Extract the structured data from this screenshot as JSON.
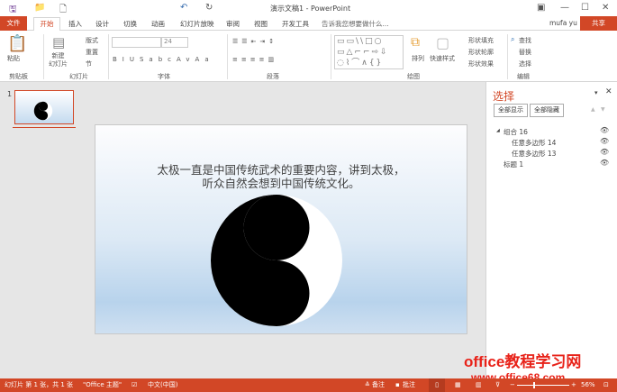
{
  "window": {
    "title": "演示文稿1 - PowerPoint"
  },
  "tabs": [
    "文件",
    "开始",
    "插入",
    "设计",
    "切换",
    "动画",
    "幻灯片放映",
    "审阅",
    "视图",
    "开发工具"
  ],
  "tell_me": "告诉我您想要做什么...",
  "user": "mufa yu",
  "share": "共享",
  "ribbon": {
    "clipboard": {
      "paste": "粘贴",
      "label": "剪贴板"
    },
    "slides": {
      "new_slide": "新建\n幻灯片",
      "layout": "版式",
      "reset": "重置",
      "section": "节",
      "label": "幻灯片"
    },
    "font": {
      "size": "24",
      "label": "字体"
    },
    "paragraph": {
      "label": "段落"
    },
    "drawing": {
      "arrange": "排列",
      "quick_styles": "快速样式",
      "fill": "形状填充",
      "outline": "形状轮廓",
      "effects": "形状效果",
      "label": "绘图"
    },
    "editing": {
      "find": "查找",
      "replace": "替换",
      "select": "选择",
      "label": "编辑"
    }
  },
  "thumbnail": {
    "number": "1"
  },
  "slide": {
    "text_line1": "太极一直是中国传统武术的重要内容，讲到太极，",
    "text_line2": "听众自然会想到中国传统文化。"
  },
  "selection_pane": {
    "title": "选择",
    "show_all": "全部显示",
    "hide_all": "全部隐藏",
    "items": [
      {
        "label": "组合 16"
      },
      {
        "label": "任意多边形 14"
      },
      {
        "label": "任意多边形 13"
      },
      {
        "label": "标题 1"
      }
    ]
  },
  "status": {
    "slide": "幻灯片 第 1 张，共 1 张",
    "theme": "\"Office 主题\"",
    "lang": "中文(中国)",
    "notes": "备注",
    "comments": "批注",
    "zoom": "56%"
  },
  "watermark": {
    "line1": "office教程学习网",
    "line2": "www.office68.com"
  },
  "colors": {
    "accent": "#d24726"
  }
}
